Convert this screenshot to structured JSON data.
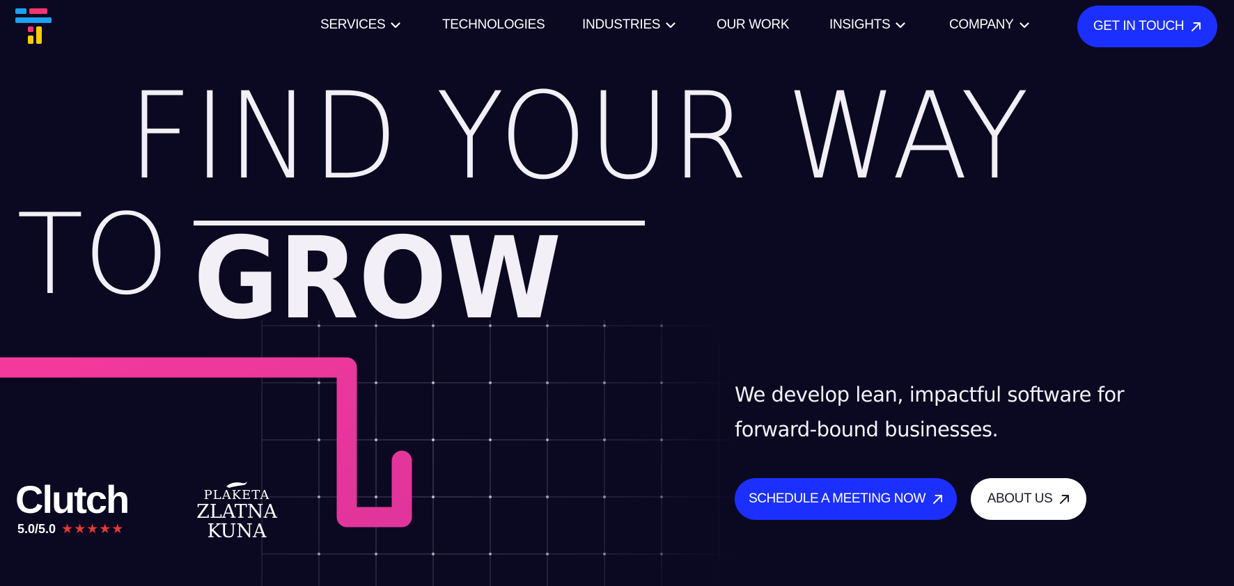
{
  "brand": {
    "logo_colors": [
      "#1da1f2",
      "#f5356f",
      "#ffcb05"
    ]
  },
  "nav": {
    "items": [
      {
        "label": "SERVICES",
        "has_dropdown": true
      },
      {
        "label": "TECHNOLOGIES",
        "has_dropdown": false
      },
      {
        "label": "INDUSTRIES",
        "has_dropdown": true
      },
      {
        "label": "OUR WORK",
        "has_dropdown": false
      },
      {
        "label": "INSIGHTS",
        "has_dropdown": true
      },
      {
        "label": "COMPANY",
        "has_dropdown": true
      }
    ],
    "cta_label": "GET IN TOUCH"
  },
  "hero": {
    "line1": "FIND YOUR WAY",
    "line2_to": "TO",
    "line2_grow": "GROW",
    "tagline": "We develop lean, impactful software for forward-bound businesses.",
    "primary_cta": "SCHEDULE A MEETING NOW",
    "secondary_cta": "ABOUT US"
  },
  "badges": {
    "clutch": {
      "name": "Clutch",
      "score": "5.0/5.0",
      "stars": 5
    },
    "award": {
      "line1": "PLAKETA",
      "line2": "ZLATNA",
      "line3": "KUNA"
    }
  },
  "colors": {
    "background": "#0b0921",
    "accent_blue": "#1b30ff",
    "accent_pink": "#f0379a",
    "star_red": "#e33b32",
    "text": "#ffffff"
  },
  "icons": {
    "dropdown": "chevron-down-icon",
    "cta_arrow": "arrow-up-right-icon"
  }
}
